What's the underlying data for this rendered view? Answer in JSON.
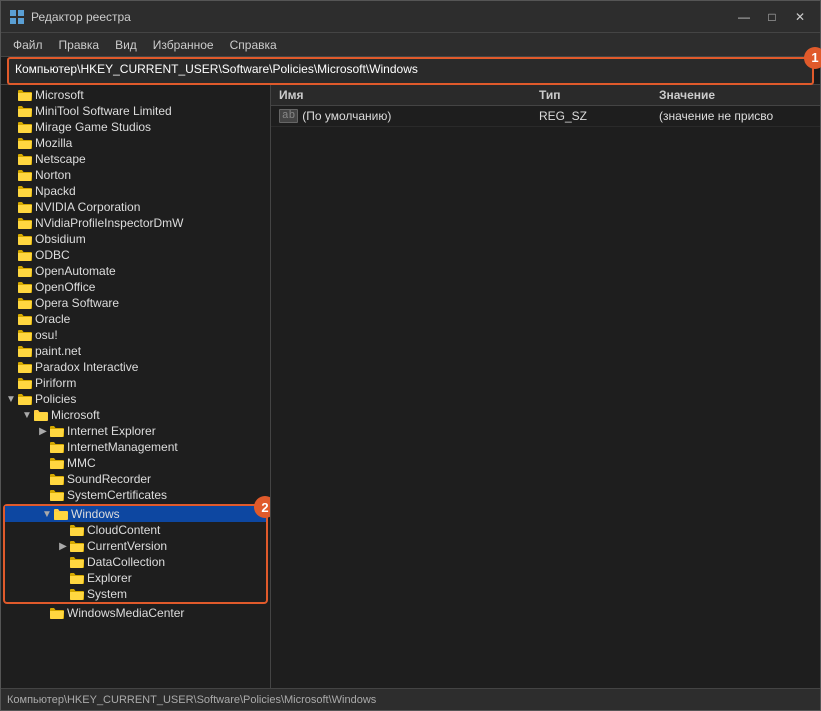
{
  "window": {
    "title": "Редактор реестра",
    "controls": [
      "—",
      "□",
      "✕"
    ]
  },
  "menu": {
    "items": [
      "Файл",
      "Правка",
      "Вид",
      "Избранное",
      "Справка"
    ]
  },
  "address": {
    "label": "",
    "path": "Компьютер\\HKEY_CURRENT_USER\\Software\\Policies\\Microsoft\\Windows",
    "badge": "1"
  },
  "detail": {
    "columns": [
      "Имя",
      "Тип",
      "Значение"
    ],
    "rows": [
      {
        "icon": "ab",
        "name": "(По умолчанию)",
        "type": "REG_SZ",
        "value": "(значение не присво"
      }
    ]
  },
  "tree": {
    "items": [
      {
        "label": "Microsoft",
        "indent": 0,
        "expanded": false,
        "hasArrow": false
      },
      {
        "label": "MiniTool Software Limited",
        "indent": 0,
        "expanded": false,
        "hasArrow": false
      },
      {
        "label": "Mirage Game Studios",
        "indent": 0,
        "expanded": false,
        "hasArrow": false
      },
      {
        "label": "Mozilla",
        "indent": 0,
        "expanded": false,
        "hasArrow": false
      },
      {
        "label": "Netscape",
        "indent": 0,
        "expanded": false,
        "hasArrow": false
      },
      {
        "label": "Norton",
        "indent": 0,
        "expanded": false,
        "hasArrow": false
      },
      {
        "label": "Npackd",
        "indent": 0,
        "expanded": false,
        "hasArrow": false
      },
      {
        "label": "NVIDIA Corporation",
        "indent": 0,
        "expanded": false,
        "hasArrow": false
      },
      {
        "label": "NVidiaProfileInspectorDmW",
        "indent": 0,
        "expanded": false,
        "hasArrow": false
      },
      {
        "label": "Obsidium",
        "indent": 0,
        "expanded": false,
        "hasArrow": false
      },
      {
        "label": "ODBC",
        "indent": 0,
        "expanded": false,
        "hasArrow": false
      },
      {
        "label": "OpenAutomate",
        "indent": 0,
        "expanded": false,
        "hasArrow": false
      },
      {
        "label": "OpenOffice",
        "indent": 0,
        "expanded": false,
        "hasArrow": false
      },
      {
        "label": "Opera Software",
        "indent": 0,
        "expanded": false,
        "hasArrow": false
      },
      {
        "label": "Oracle",
        "indent": 0,
        "expanded": false,
        "hasArrow": false
      },
      {
        "label": "osu!",
        "indent": 0,
        "expanded": false,
        "hasArrow": false
      },
      {
        "label": "paint.net",
        "indent": 0,
        "expanded": false,
        "hasArrow": false
      },
      {
        "label": "Paradox Interactive",
        "indent": 0,
        "expanded": false,
        "hasArrow": false
      },
      {
        "label": "Piriform",
        "indent": 0,
        "expanded": false,
        "hasArrow": false
      },
      {
        "label": "Policies",
        "indent": 0,
        "expanded": true,
        "hasArrow": false
      },
      {
        "label": "Microsoft",
        "indent": 1,
        "expanded": true,
        "hasArrow": false
      },
      {
        "label": "Internet Explorer",
        "indent": 2,
        "expanded": false,
        "hasArrow": true
      },
      {
        "label": "InternetManagement",
        "indent": 2,
        "expanded": false,
        "hasArrow": false
      },
      {
        "label": "MMC",
        "indent": 2,
        "expanded": false,
        "hasArrow": false
      },
      {
        "label": "SoundRecorder",
        "indent": 2,
        "expanded": false,
        "hasArrow": false
      },
      {
        "label": "SystemCertificates",
        "indent": 2,
        "expanded": false,
        "hasArrow": false
      },
      {
        "label": "Windows",
        "indent": 2,
        "expanded": true,
        "hasArrow": false,
        "selected": true
      },
      {
        "label": "CloudContent",
        "indent": 3,
        "expanded": false,
        "hasArrow": false
      },
      {
        "label": "CurrentVersion",
        "indent": 3,
        "expanded": false,
        "hasArrow": true
      },
      {
        "label": "DataCollection",
        "indent": 3,
        "expanded": false,
        "hasArrow": false
      },
      {
        "label": "Explorer",
        "indent": 3,
        "expanded": false,
        "hasArrow": false
      },
      {
        "label": "System",
        "indent": 3,
        "expanded": false,
        "hasArrow": false
      },
      {
        "label": "WindowsMediaCenter",
        "indent": 2,
        "expanded": false,
        "hasArrow": false
      }
    ]
  }
}
